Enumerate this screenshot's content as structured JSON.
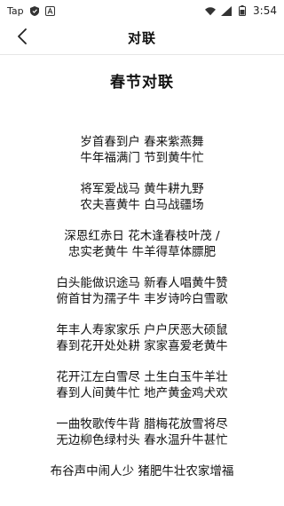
{
  "status_bar": {
    "carrier": "Tap",
    "time": "3:54"
  },
  "header": {
    "title": "对联"
  },
  "main": {
    "heading": "春节对联",
    "couplets": [
      {
        "line1": "岁首春到户 春来紫燕舞",
        "line2": "牛年福满门 节到黄牛忙"
      },
      {
        "line1": "将军爱战马 黄牛耕九野",
        "line2": "农夫喜黄牛 白马战疆场"
      },
      {
        "line1": "深恩红赤日 花木逢春枝叶茂 /",
        "line2": "忠实老黄牛 牛羊得草体膘肥"
      },
      {
        "line1": "白头能做识途马 新春人唱黄牛赞",
        "line2": "俯首甘为孺子牛 丰岁诗吟白雪歌"
      },
      {
        "line1": "年丰人寿家家乐 户户厌恶大硕鼠",
        "line2": "春到花开处处耕 家家喜爱老黄牛"
      },
      {
        "line1": "花开江左白雪尽 土生白玉牛羊壮",
        "line2": "春到人间黄牛忙 地产黄金鸡犬欢"
      },
      {
        "line1": "一曲牧歌传牛背 腊梅花放雪将尽",
        "line2": "无边柳色绿村头 春水温升牛甚忙"
      },
      {
        "line1": "布谷声中闹人少 猪肥牛壮农家增福",
        "line2": ""
      }
    ]
  }
}
